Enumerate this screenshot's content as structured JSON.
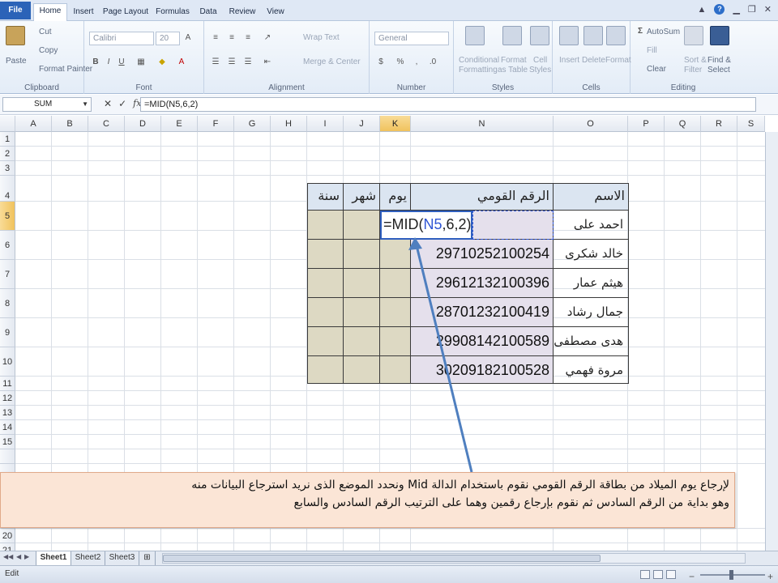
{
  "tabs": [
    "File",
    "Home",
    "Insert",
    "Page Layout",
    "Formulas",
    "Data",
    "Review",
    "View"
  ],
  "ribbon": {
    "clipboard": {
      "paste": "Paste",
      "cut": "Cut",
      "copy": "Copy",
      "format_painter": "Format Painter",
      "label": "Clipboard"
    },
    "font": {
      "name": "Calibri",
      "size": "20",
      "label": "Font"
    },
    "alignment": {
      "wrap": "Wrap Text",
      "merge": "Merge & Center",
      "label": "Alignment"
    },
    "number": {
      "format": "General",
      "label": "Number"
    },
    "styles": {
      "cond": "Conditional",
      "cond2": "Formatting",
      "fmt_table": "Format",
      "fmt_table2": "as Table",
      "cell_styles": "Cell",
      "cell_styles2": "Styles",
      "label": "Styles"
    },
    "cells": {
      "insert": "Insert",
      "delete": "Delete",
      "format": "Format",
      "label": "Cells"
    },
    "editing": {
      "autosum": "AutoSum",
      "fill": "Fill",
      "clear": "Clear",
      "sort": "Sort &",
      "sort2": "Filter",
      "find": "Find &",
      "find2": "Select",
      "label": "Editing"
    }
  },
  "formula_bar": {
    "name_box": "SUM",
    "formula": "=MID(N5,6,2)"
  },
  "columns": [
    "A",
    "B",
    "C",
    "D",
    "E",
    "F",
    "G",
    "H",
    "I",
    "J",
    "K",
    "N",
    "O",
    "P",
    "Q",
    "R",
    "S"
  ],
  "rows": [
    "1",
    "2",
    "3",
    "4",
    "5",
    "6",
    "7",
    "8",
    "9",
    "10",
    "11",
    "12",
    "13",
    "14",
    "15",
    "",
    "",
    "20",
    "21"
  ],
  "table": {
    "headers": {
      "name": "الاسم",
      "national_id": "الرقم القومي",
      "day": "يوم",
      "month": "شهر",
      "year": "سنة"
    },
    "records": [
      {
        "name": "احمد على",
        "national_id": ""
      },
      {
        "name": "خالد شكرى",
        "national_id": "29710252100254"
      },
      {
        "name": "هيثم عمار",
        "national_id": "29612132100396"
      },
      {
        "name": "جمال رشاد",
        "national_id": "28701232100419"
      },
      {
        "name": "هدى مصطفى",
        "national_id": "29908142100589"
      },
      {
        "name": "مروة فهمي",
        "national_id": "30209182100528"
      }
    ],
    "editing_formula": {
      "prefix": "=MID(",
      "ref": "N5",
      "suffix": ",6,2)"
    }
  },
  "caption": {
    "line1": "لإرجاع يوم الميلاد من بطاقة الرقم القومي نقوم باستخدام الدالة Mid ونحدد الموضع الذى نريد استرجاع البيانات منه",
    "line2": "وهو بداية من الرقم السادس ثم نقوم بإرجاع رقمين وهما على الترتيب الرقم السادس والسابع"
  },
  "sheets": [
    "Sheet1",
    "Sheet2",
    "Sheet3"
  ],
  "status": {
    "mode": "Edit"
  },
  "colors": {
    "accent": "#2b63b8",
    "tan": "#ddd9c3",
    "lavender": "#e5e0ec",
    "header_blue": "#dbe5f1",
    "arrow": "#4f7fbf"
  }
}
